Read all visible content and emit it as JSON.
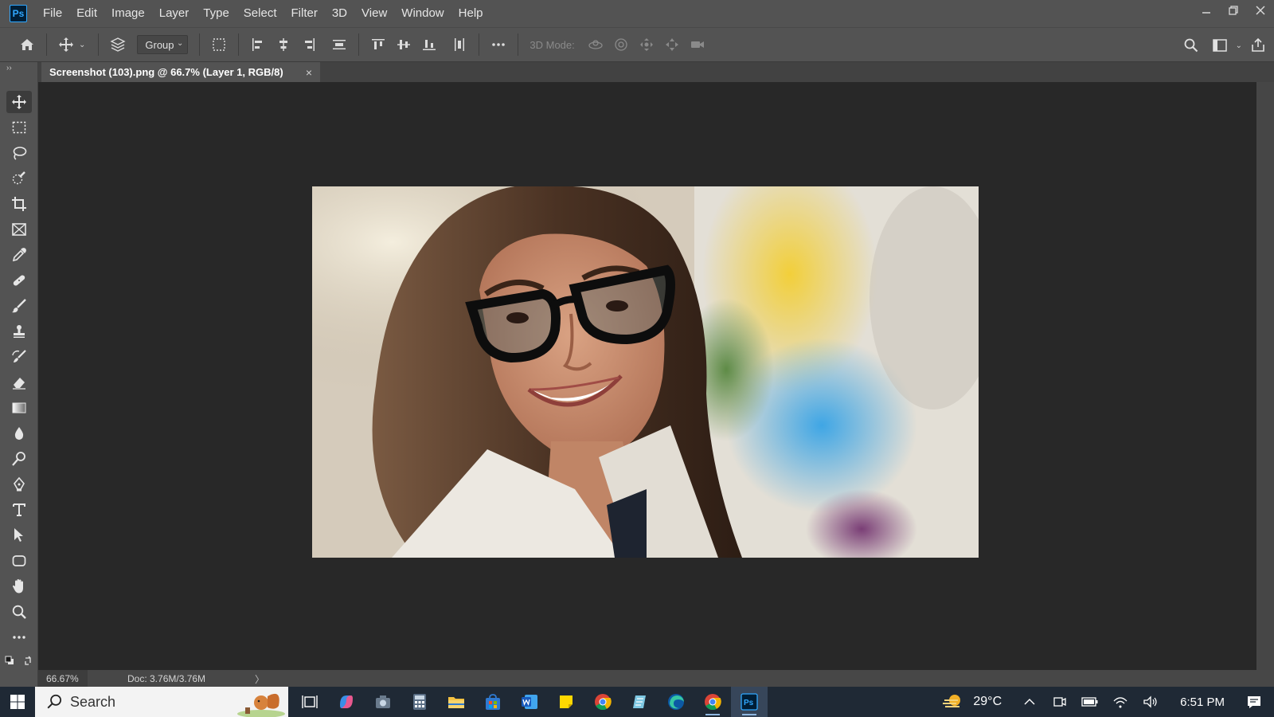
{
  "app": {
    "logo": "Ps"
  },
  "menu": [
    "File",
    "Edit",
    "Image",
    "Layer",
    "Type",
    "Select",
    "Filter",
    "3D",
    "View",
    "Window",
    "Help"
  ],
  "options": {
    "group_value": "Group",
    "mode3d_label": "3D Mode:"
  },
  "document": {
    "tab_title": "Screenshot (103).png @ 66.7% (Layer 1, RGB/8)",
    "close_glyph": "×"
  },
  "status": {
    "zoom": "66.67%",
    "doc_info": "Doc: 3.76M/3.76M",
    "arrow": "〉"
  },
  "taskbar": {
    "search_label": "Search",
    "temperature": "29°C",
    "time": "6:51 PM"
  },
  "colors": {
    "panel": "#535353",
    "canvas": "#282828",
    "taskbar": "#1f2935",
    "accent": "#31a8ff"
  }
}
